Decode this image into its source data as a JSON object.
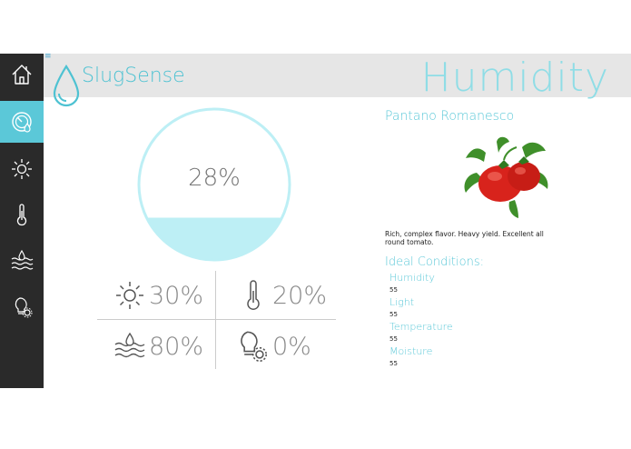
{
  "app": {
    "menu_glyph": "≡",
    "logo_text": "SlugSense",
    "page_title": "Humidity",
    "accent_color": "#5bc8d8"
  },
  "sidebar": {
    "items": [
      {
        "icon": "home-icon",
        "active": false
      },
      {
        "icon": "humidity-gauge-icon",
        "active": true
      },
      {
        "icon": "sun-icon",
        "active": false
      },
      {
        "icon": "thermometer-icon",
        "active": false
      },
      {
        "icon": "moisture-icon",
        "active": false
      },
      {
        "icon": "bulb-gear-icon",
        "active": false
      }
    ]
  },
  "gauge": {
    "value_text": "28%",
    "fill_fraction": 0.28
  },
  "stats": {
    "light": "30%",
    "temperature": "20%",
    "moisture": "80%",
    "bulb": "0%"
  },
  "plant": {
    "name": "Pantano Romanesco",
    "description": "Rich, complex flavor. Heavy yield. Excellent all round tomato.",
    "ideal_title": "Ideal Conditions:",
    "conditions": [
      {
        "label": "Humidity",
        "value": "55"
      },
      {
        "label": "Light",
        "value": "55"
      },
      {
        "label": "Temperature",
        "value": "55"
      },
      {
        "label": "Moisture",
        "value": "55"
      }
    ]
  }
}
